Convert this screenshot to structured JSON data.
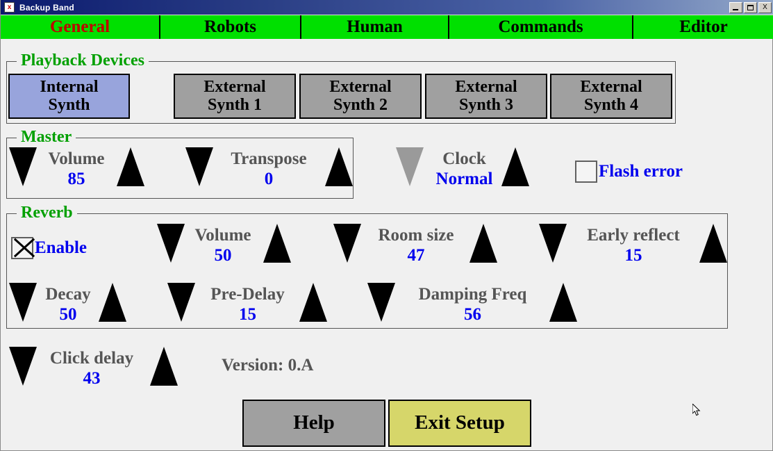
{
  "window": {
    "title": "Backup Band",
    "icon": "close-box-icon",
    "controls": {
      "minimize": "minimize-icon",
      "maximize": "maximize-icon",
      "close": "X"
    }
  },
  "tabs": [
    {
      "label": "General",
      "active": true
    },
    {
      "label": "Robots",
      "active": false
    },
    {
      "label": "Human",
      "active": false
    },
    {
      "label": "Commands",
      "active": false
    },
    {
      "label": "Editor",
      "active": false
    }
  ],
  "playback_devices": {
    "legend": "Playback Devices",
    "buttons": [
      {
        "line1": "Internal",
        "line2": "Synth",
        "selected": true
      },
      {
        "line1": "External",
        "line2": "Synth 1",
        "selected": false
      },
      {
        "line1": "External",
        "line2": "Synth 2",
        "selected": false
      },
      {
        "line1": "External",
        "line2": "Synth 3",
        "selected": false
      },
      {
        "line1": "External",
        "line2": "Synth 4",
        "selected": false
      }
    ]
  },
  "master": {
    "legend": "Master",
    "volume": {
      "label": "Volume",
      "value": "85"
    },
    "transpose": {
      "label": "Transpose",
      "value": "0"
    }
  },
  "clock": {
    "label": "Clock",
    "value": "Normal",
    "down_disabled": true
  },
  "flash_error": {
    "label": "Flash error",
    "checked": false
  },
  "reverb": {
    "legend": "Reverb",
    "enable": {
      "label": "Enable",
      "checked": true
    },
    "volume": {
      "label": "Volume",
      "value": "50"
    },
    "room_size": {
      "label": "Room size",
      "value": "47"
    },
    "early_reflect": {
      "label": "Early reflect",
      "value": "15"
    },
    "decay": {
      "label": "Decay",
      "value": "50"
    },
    "pre_delay": {
      "label": "Pre-Delay",
      "value": "15"
    },
    "damping_freq": {
      "label": "Damping Freq",
      "value": "56"
    }
  },
  "click_delay": {
    "label": "Click delay",
    "value": "43"
  },
  "version_text": "Version: 0.A",
  "footer": {
    "help_label": "Help",
    "exit_label": "Exit Setup"
  },
  "colors": {
    "tab_bar": "#00e000",
    "active_tab_text": "#c00000",
    "legend_green": "#00a000",
    "value_blue": "#0000ee",
    "label_gray": "#555555",
    "selected_button": "#98a4dc",
    "button_gray": "#a0a0a0",
    "exit_button": "#d6d66a",
    "titlebar_start": "#0b1a6e"
  }
}
